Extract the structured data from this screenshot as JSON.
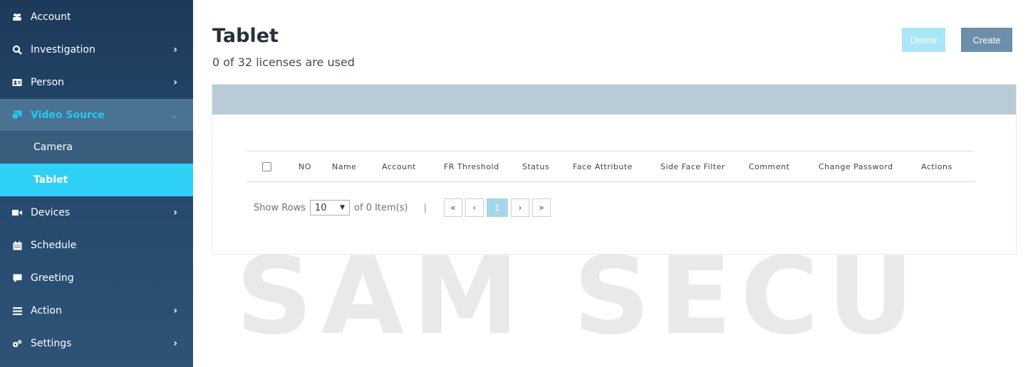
{
  "sidebar": {
    "items": [
      {
        "label": "Account",
        "icon": "users-icon",
        "has_chevron": false
      },
      {
        "label": "Investigation",
        "icon": "search-icon",
        "has_chevron": true
      },
      {
        "label": "Person",
        "icon": "id-card-icon",
        "has_chevron": true
      },
      {
        "label": "Video Source",
        "icon": "video-source-icon",
        "has_chevron": true,
        "expanded": true
      },
      {
        "label": "Devices",
        "icon": "video-camera-icon",
        "has_chevron": true
      },
      {
        "label": "Schedule",
        "icon": "calendar-icon",
        "has_chevron": false
      },
      {
        "label": "Greeting",
        "icon": "comment-icon",
        "has_chevron": false
      },
      {
        "label": "Action",
        "icon": "list-icon",
        "has_chevron": true
      },
      {
        "label": "Settings",
        "icon": "gears-icon",
        "has_chevron": true
      }
    ],
    "sub_items": [
      {
        "label": "Camera",
        "active": false
      },
      {
        "label": "Tablet",
        "active": true
      }
    ]
  },
  "page": {
    "title": "Tablet",
    "subtitle": "0 of 32 licenses are used"
  },
  "toolbar": {
    "delete_label": "Delete",
    "create_label": "Create"
  },
  "table": {
    "columns": [
      "NO",
      "Name",
      "Account",
      "FR Threshold",
      "Status",
      "Face Attribute",
      "Side Face Filter",
      "Comment",
      "Change Password",
      "Actions"
    ],
    "rows": []
  },
  "pager": {
    "show_rows_label": "Show Rows",
    "rows_per_page": "10",
    "items_text": "of 0 Item(s)",
    "separator": "|",
    "first": "«",
    "prev": "‹",
    "current_page": "1",
    "next": "›",
    "last": "»"
  },
  "colors": {
    "sidebar": "#1d3a5a",
    "active_sub": "#2ed1f5",
    "accent": "#27c8f0",
    "create_button": "#6c8eaa",
    "delete_button": "#a9e6f7",
    "panel_header": "#b9cbd6"
  },
  "watermark": "SAM SECU"
}
